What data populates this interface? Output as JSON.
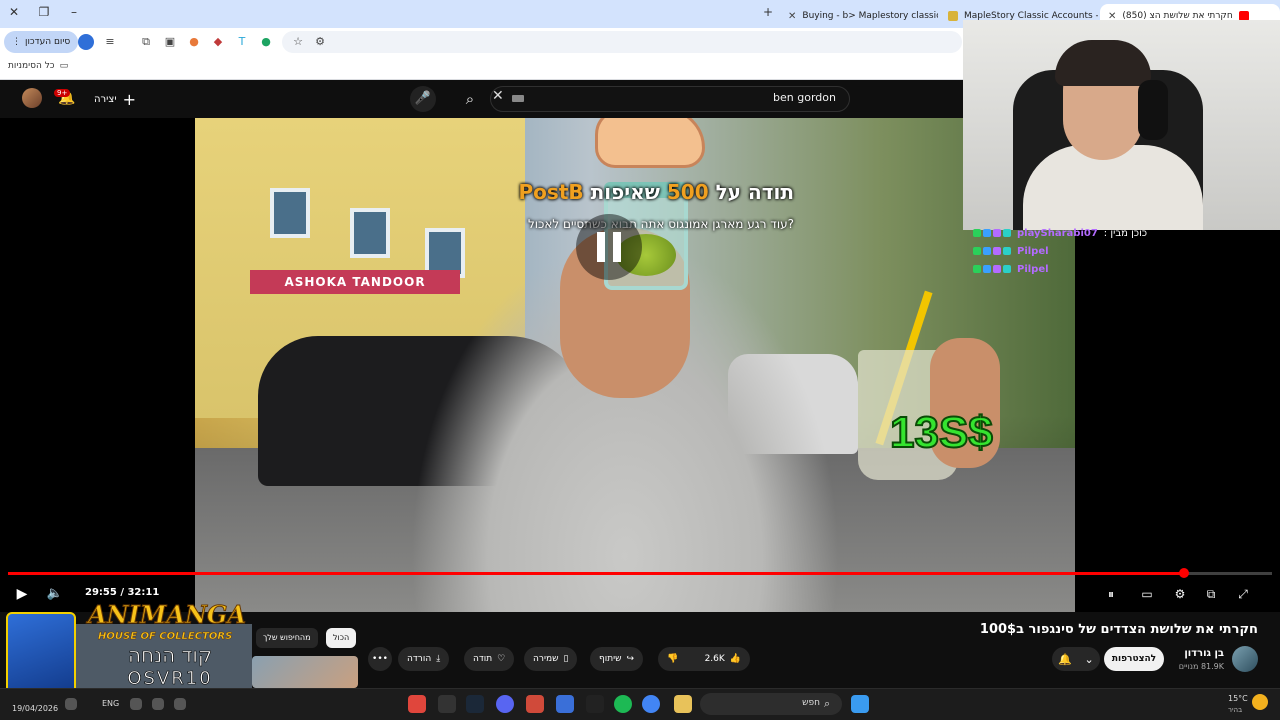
{
  "browser": {
    "tabs": [
      {
        "title": "(850) חקרתי את שלושת הצ"
      },
      {
        "title": "MapleStory Classic Accounts - I"
      },
      {
        "title": "Buying - b> Maplestory classic"
      }
    ],
    "exit_label": "סיום העדכון",
    "bookmarks_label": "כל הסימניות"
  },
  "youtube": {
    "search_query": "ben gordon",
    "create_label": "יצירה",
    "notifications_badge": "9+"
  },
  "video": {
    "donation_prefix": "תודה על",
    "donation_amount": "500",
    "donation_unit": "שאיפות",
    "donation_name": "PostB",
    "donation_message": "?עוד רגע מארגן אמונגוס אתה תבוא כשתסיים לאכול",
    "price_overlay": "13S$",
    "storefront_sign": "ASHOKA TANDOOR",
    "time_current": "29:55",
    "time_total": "32:11",
    "progress": 0.93
  },
  "stream": {
    "chat": [
      {
        "name": "playSharabi07",
        "text": ": כוכן מבין"
      },
      {
        "name": "Pilpel",
        "text": ""
      },
      {
        "name": "Pilpel",
        "text": ""
      }
    ]
  },
  "details": {
    "title": "חקרתי את שלושת הצדדים של סינגפור ב100$",
    "channel_name": "בן גורדון",
    "subscribers": "81.9K מנויים",
    "join_label": "להצטרפות",
    "likes": "2.6K",
    "share_label": "שיתוף",
    "save_label": "שמירה",
    "thanks_label": "תודה",
    "download_label": "הורדה",
    "chip_all": "הכול",
    "chip_search": "מהחיפוש שלך"
  },
  "promo": {
    "brand": "ANIMANGA",
    "subtitle": "HOUSE OF COLLECTORS",
    "code_label": "קוד הנחה",
    "code": "OSVR10"
  },
  "taskbar": {
    "date": "19/04/2026",
    "lang": "ENG",
    "search_label": "חפש",
    "temperature": "15°C",
    "weather": "בהיר"
  }
}
